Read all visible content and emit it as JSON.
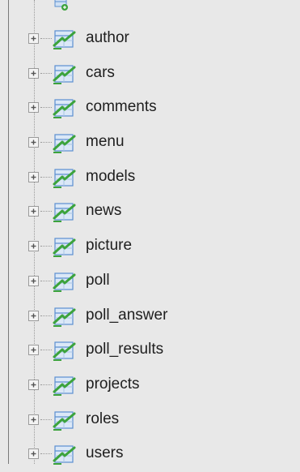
{
  "tree": {
    "items": [
      {
        "label": "author"
      },
      {
        "label": "cars"
      },
      {
        "label": "comments"
      },
      {
        "label": "menu"
      },
      {
        "label": "models"
      },
      {
        "label": "news"
      },
      {
        "label": "picture"
      },
      {
        "label": "poll"
      },
      {
        "label": "poll_answer"
      },
      {
        "label": "poll_results"
      },
      {
        "label": "projects"
      },
      {
        "label": "roles"
      },
      {
        "label": "users"
      }
    ]
  },
  "icons": {
    "expander": "plus-icon",
    "table": "table-icon",
    "new_table": "new-table-icon"
  },
  "colors": {
    "background": "#e8e8e8",
    "tree_line": "#7a7a7a",
    "icon_blue": "#5b8fd0",
    "icon_green": "#3ca33c",
    "text": "#1e1e1e"
  }
}
